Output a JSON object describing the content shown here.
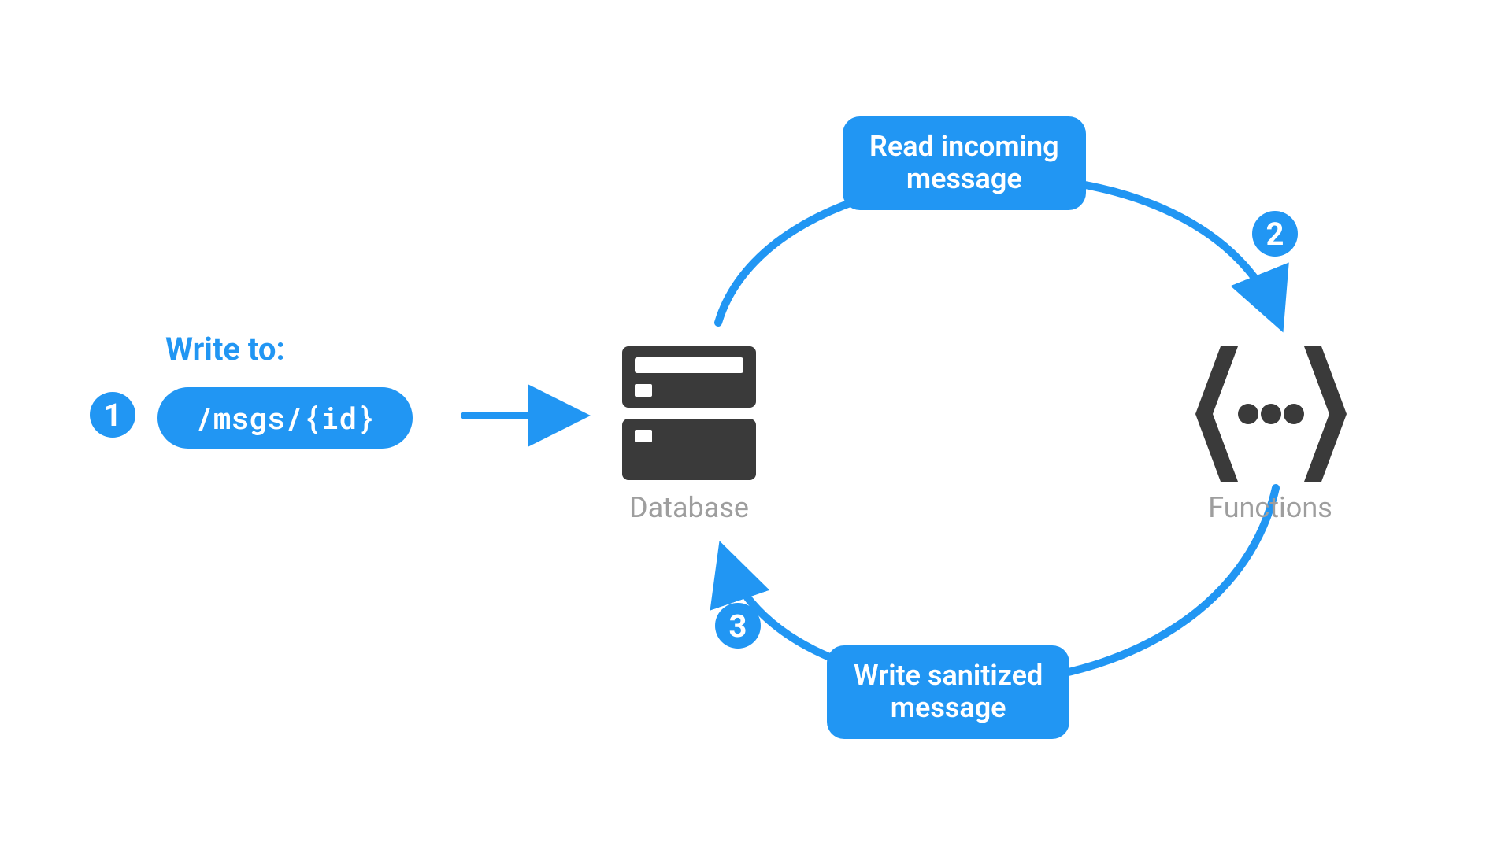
{
  "colors": {
    "primary": "#2196f3",
    "icon_dark": "#3a3a3a",
    "caption_gray": "#9e9e9e",
    "white": "#ffffff"
  },
  "write_to": {
    "label": "Write to:",
    "path": "/msgs/{id}"
  },
  "nodes": {
    "database_caption": "Database",
    "functions_caption": "Functions"
  },
  "labels": {
    "read_incoming_line1": "Read incoming",
    "read_incoming_line2": "message",
    "write_sanitized_line1": "Write sanitized",
    "write_sanitized_line2": "message"
  },
  "steps": {
    "s1": "1",
    "s2": "2",
    "s3": "3"
  }
}
